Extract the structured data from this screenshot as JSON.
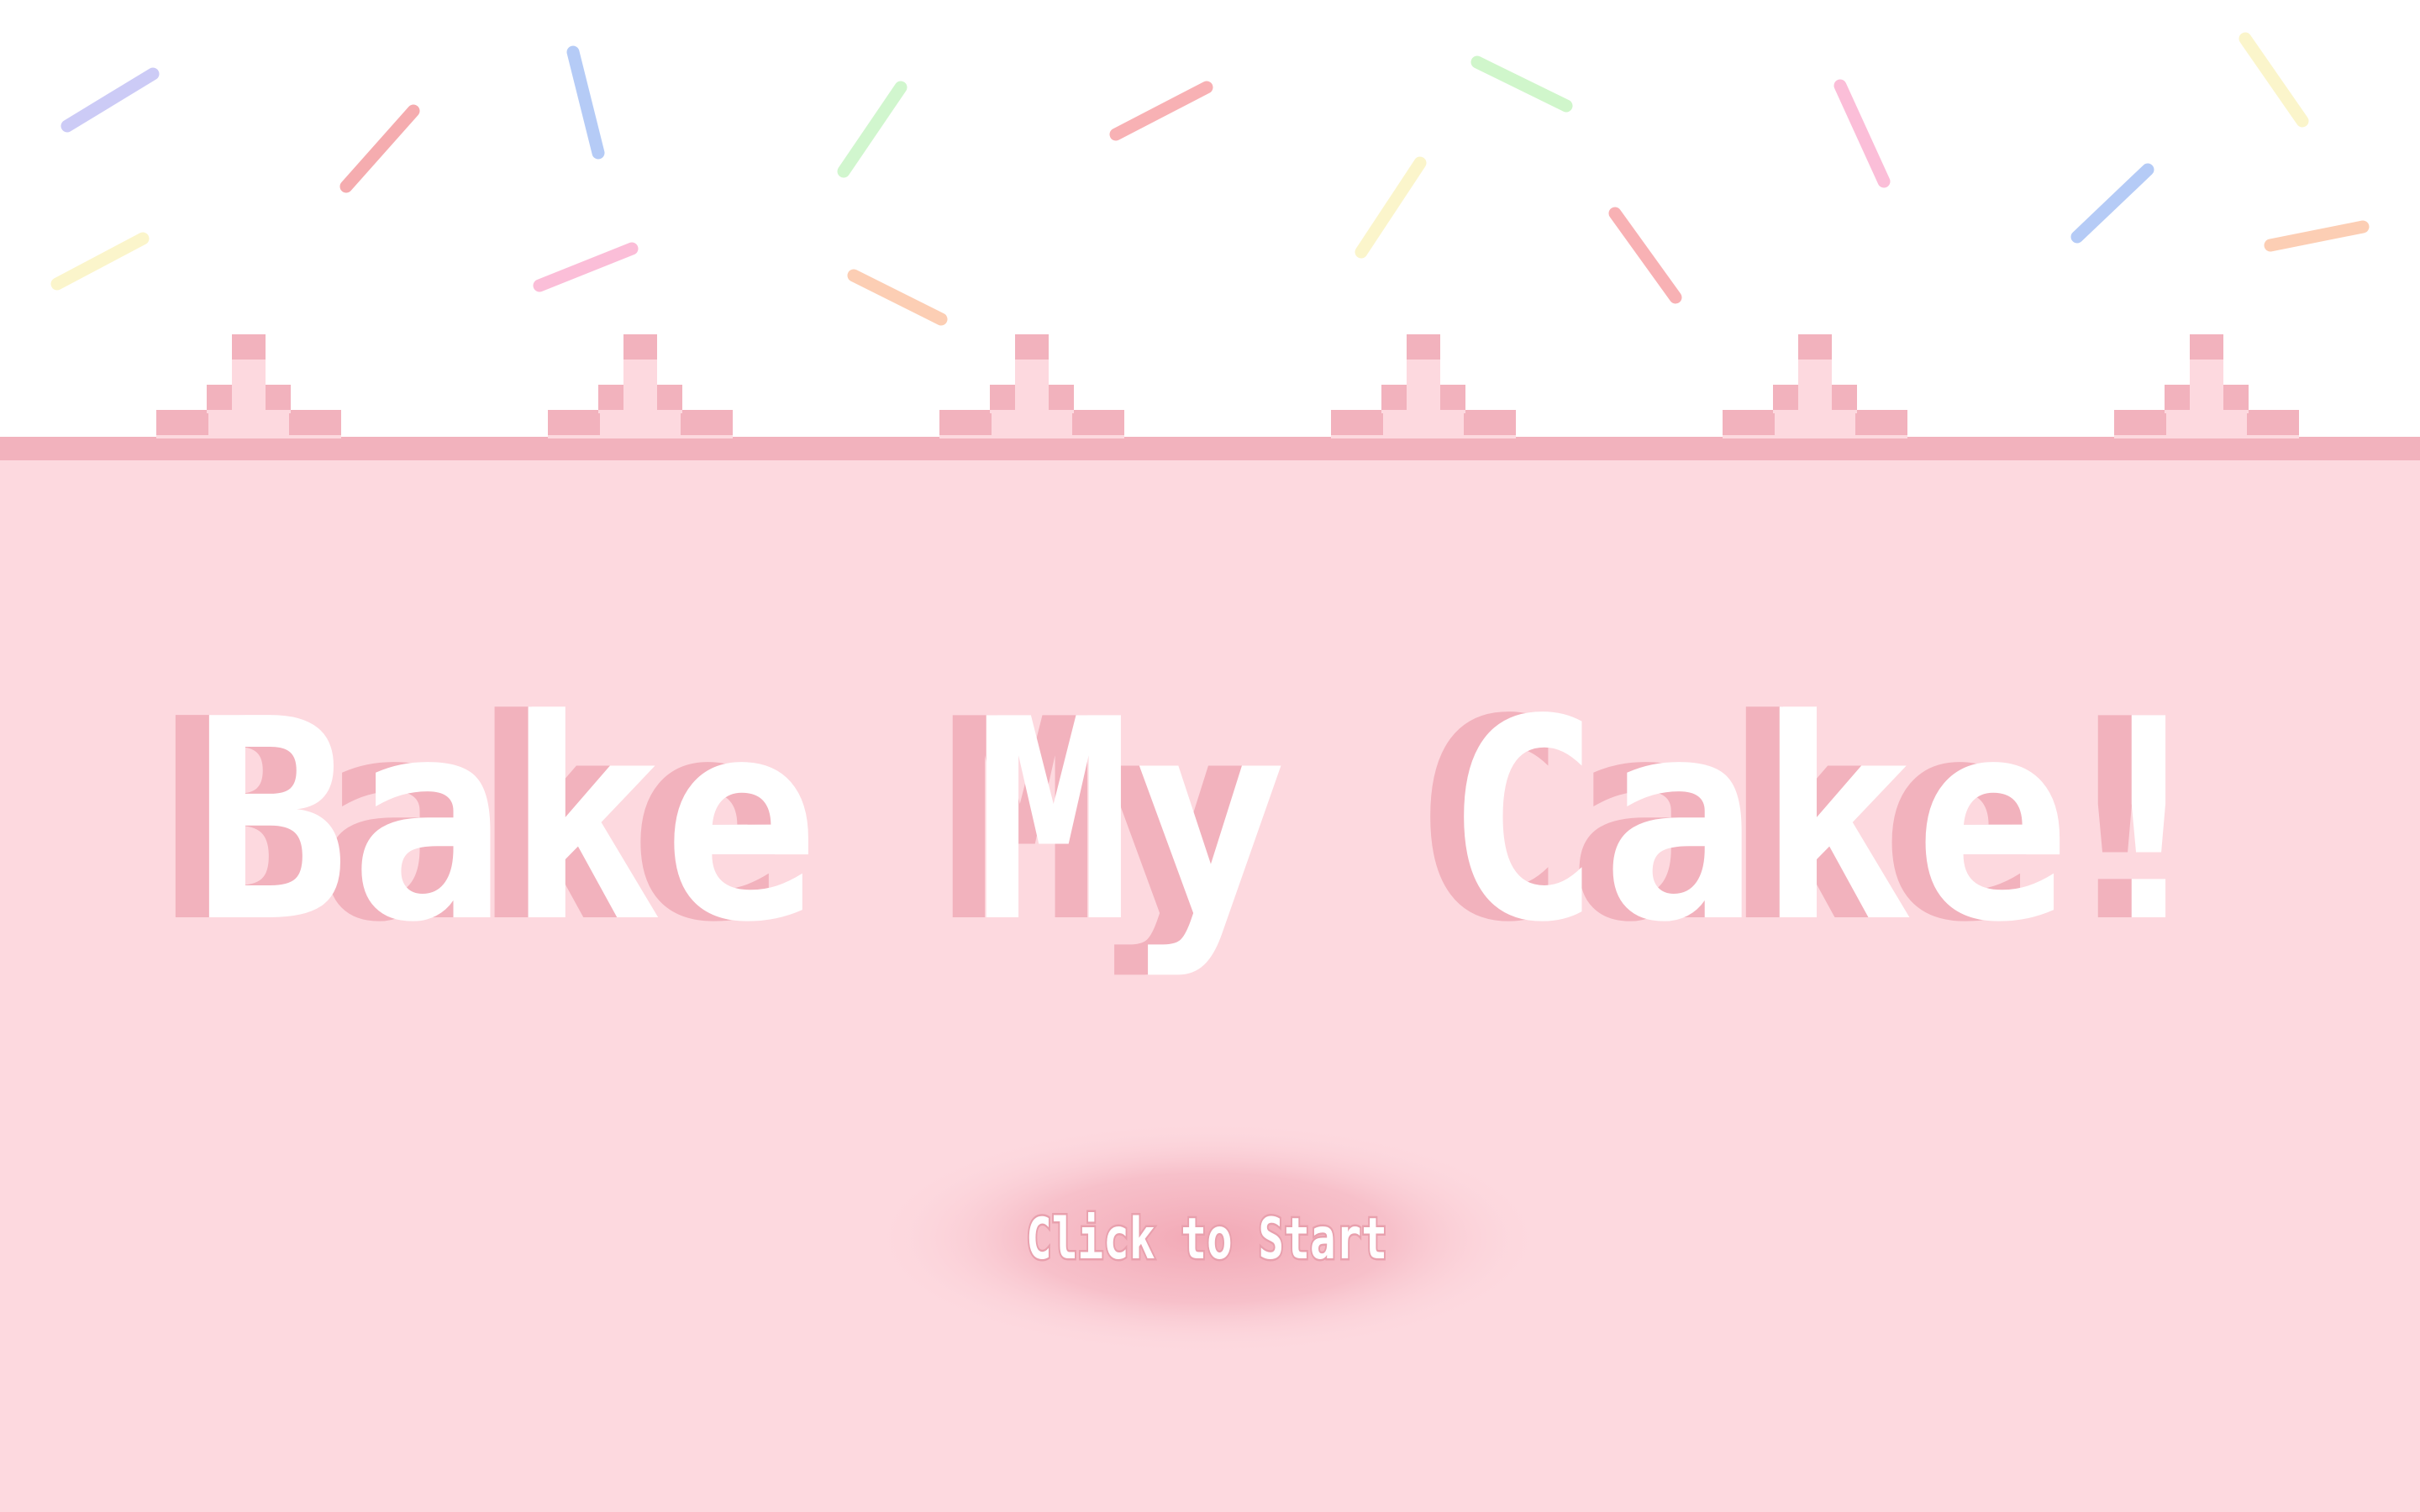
{
  "game": {
    "title": "Bake My Cake!",
    "start_label": "Click to Start"
  },
  "colors": {
    "background": "#ffffff",
    "frosting": "#fdd9df",
    "frosting_edge": "#f2b2bd",
    "title_fill": "#ffffff",
    "title_shadow": "#f2b2bd",
    "start_glow": "#f2a8b5"
  },
  "decorations": {
    "sprinkle_colors": [
      "lavender",
      "red",
      "blue",
      "mint",
      "yellow",
      "pink",
      "peach",
      "salmon"
    ]
  }
}
